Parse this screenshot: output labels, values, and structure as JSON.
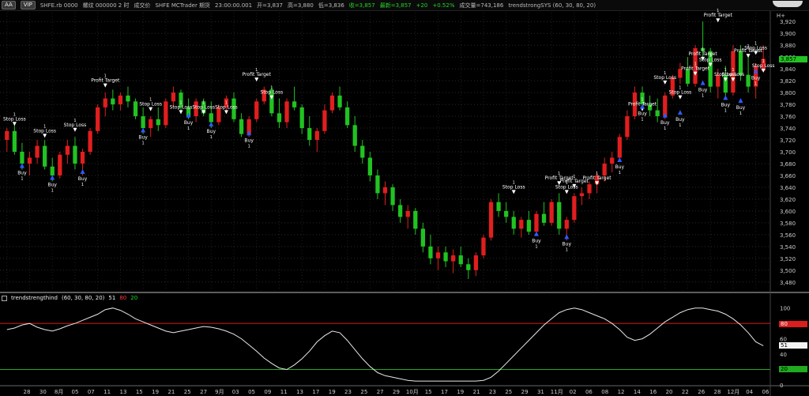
{
  "toolbar": {
    "zoom_label": "AA",
    "tag_label": "VIP",
    "symbol": "SHFE.rb 0000",
    "name": "螺纹 000000 2 时",
    "extra1": "成交价",
    "extra2": "SHFE MCTrader 期货",
    "time": "23:00:00.001",
    "open": "开=3,837",
    "high": "高=3,880",
    "low": "低=3,836",
    "close": "收=3,857",
    "latest": "最新=3,857",
    "change": "+20",
    "change_pct": "+0.52%",
    "volume": "成交量=743,186",
    "strategy": "trendstrongSYS (60, 30, 80, 20)",
    "right_label": "H+"
  },
  "price_panel": {
    "current_price": "3,857",
    "y_ticks": [
      "3,920",
      "3,900",
      "3,880",
      "3,860",
      "3,840",
      "3,820",
      "3,800",
      "3,780",
      "3,760",
      "3,740",
      "3,720",
      "3,700",
      "3,680",
      "3,660",
      "3,640",
      "3,620",
      "3,600",
      "3,580",
      "3,560",
      "3,540",
      "3,520",
      "3,500",
      "3,480"
    ]
  },
  "indicator_panel": {
    "name": "trendstrengthind",
    "params": "(60, 30, 80, 20)",
    "value": "51",
    "upper": "80",
    "lower": "20",
    "y_ticks": [
      "100",
      "80",
      "60",
      "40",
      "20",
      "0"
    ],
    "right_tags": {
      "upper": "80",
      "value": "51",
      "lower": "20"
    }
  },
  "x_axis": {
    "labels": [
      "28",
      "30",
      "8月",
      "05",
      "07",
      "11",
      "13",
      "15",
      "19",
      "21",
      "25",
      "27",
      "9月",
      "03",
      "05",
      "09",
      "11",
      "13",
      "17",
      "19",
      "23",
      "25",
      "27",
      "29",
      "10月",
      "15",
      "17",
      "19",
      "21",
      "23",
      "25",
      "29",
      "31",
      "11月",
      "02",
      "06",
      "08",
      "12",
      "14",
      "16",
      "20",
      "22",
      "26",
      "28",
      "12月",
      "04",
      "06"
    ]
  },
  "chart_data": {
    "type": "candlestick",
    "ylim": [
      3465,
      3935
    ],
    "candles": [
      {
        "i": 0,
        "o": 3720,
        "h": 3740,
        "l": 3700,
        "c": 3735
      },
      {
        "i": 1,
        "o": 3735,
        "h": 3745,
        "l": 3695,
        "c": 3700
      },
      {
        "i": 2,
        "o": 3700,
        "h": 3715,
        "l": 3670,
        "c": 3680
      },
      {
        "i": 3,
        "o": 3680,
        "h": 3700,
        "l": 3660,
        "c": 3690
      },
      {
        "i": 4,
        "o": 3690,
        "h": 3720,
        "l": 3680,
        "c": 3710
      },
      {
        "i": 5,
        "o": 3710,
        "h": 3720,
        "l": 3670,
        "c": 3675
      },
      {
        "i": 6,
        "o": 3675,
        "h": 3690,
        "l": 3650,
        "c": 3660
      },
      {
        "i": 7,
        "o": 3660,
        "h": 3700,
        "l": 3655,
        "c": 3695
      },
      {
        "i": 8,
        "o": 3695,
        "h": 3720,
        "l": 3680,
        "c": 3710
      },
      {
        "i": 9,
        "o": 3710,
        "h": 3725,
        "l": 3670,
        "c": 3680
      },
      {
        "i": 10,
        "o": 3680,
        "h": 3705,
        "l": 3660,
        "c": 3700
      },
      {
        "i": 11,
        "o": 3700,
        "h": 3740,
        "l": 3695,
        "c": 3735
      },
      {
        "i": 12,
        "o": 3735,
        "h": 3780,
        "l": 3730,
        "c": 3775
      },
      {
        "i": 13,
        "o": 3775,
        "h": 3800,
        "l": 3760,
        "c": 3790
      },
      {
        "i": 14,
        "o": 3790,
        "h": 3805,
        "l": 3770,
        "c": 3780
      },
      {
        "i": 15,
        "o": 3780,
        "h": 3800,
        "l": 3770,
        "c": 3795
      },
      {
        "i": 16,
        "o": 3795,
        "h": 3810,
        "l": 3775,
        "c": 3785
      },
      {
        "i": 17,
        "o": 3785,
        "h": 3790,
        "l": 3755,
        "c": 3760
      },
      {
        "i": 18,
        "o": 3760,
        "h": 3775,
        "l": 3730,
        "c": 3740
      },
      {
        "i": 19,
        "o": 3740,
        "h": 3760,
        "l": 3725,
        "c": 3755
      },
      {
        "i": 20,
        "o": 3755,
        "h": 3775,
        "l": 3735,
        "c": 3745
      },
      {
        "i": 21,
        "o": 3745,
        "h": 3790,
        "l": 3740,
        "c": 3785
      },
      {
        "i": 22,
        "o": 3785,
        "h": 3810,
        "l": 3775,
        "c": 3800
      },
      {
        "i": 23,
        "o": 3800,
        "h": 3805,
        "l": 3770,
        "c": 3775
      },
      {
        "i": 24,
        "o": 3775,
        "h": 3790,
        "l": 3755,
        "c": 3760
      },
      {
        "i": 25,
        "o": 3760,
        "h": 3790,
        "l": 3750,
        "c": 3785
      },
      {
        "i": 26,
        "o": 3785,
        "h": 3790,
        "l": 3760,
        "c": 3765
      },
      {
        "i": 27,
        "o": 3765,
        "h": 3785,
        "l": 3740,
        "c": 3750
      },
      {
        "i": 28,
        "o": 3750,
        "h": 3780,
        "l": 3745,
        "c": 3775
      },
      {
        "i": 29,
        "o": 3775,
        "h": 3795,
        "l": 3765,
        "c": 3790
      },
      {
        "i": 30,
        "o": 3790,
        "h": 3800,
        "l": 3750,
        "c": 3755
      },
      {
        "i": 31,
        "o": 3755,
        "h": 3765,
        "l": 3725,
        "c": 3730
      },
      {
        "i": 32,
        "o": 3730,
        "h": 3760,
        "l": 3725,
        "c": 3755
      },
      {
        "i": 33,
        "o": 3755,
        "h": 3790,
        "l": 3750,
        "c": 3785
      },
      {
        "i": 34,
        "o": 3785,
        "h": 3810,
        "l": 3780,
        "c": 3805
      },
      {
        "i": 35,
        "o": 3805,
        "h": 3810,
        "l": 3760,
        "c": 3765
      },
      {
        "i": 36,
        "o": 3765,
        "h": 3790,
        "l": 3740,
        "c": 3750
      },
      {
        "i": 37,
        "o": 3750,
        "h": 3790,
        "l": 3740,
        "c": 3785
      },
      {
        "i": 38,
        "o": 3785,
        "h": 3810,
        "l": 3770,
        "c": 3775
      },
      {
        "i": 39,
        "o": 3775,
        "h": 3780,
        "l": 3730,
        "c": 3740
      },
      {
        "i": 40,
        "o": 3740,
        "h": 3760,
        "l": 3710,
        "c": 3720
      },
      {
        "i": 41,
        "o": 3720,
        "h": 3740,
        "l": 3700,
        "c": 3735
      },
      {
        "i": 42,
        "o": 3735,
        "h": 3780,
        "l": 3730,
        "c": 3770
      },
      {
        "i": 43,
        "o": 3770,
        "h": 3800,
        "l": 3765,
        "c": 3795
      },
      {
        "i": 44,
        "o": 3795,
        "h": 3810,
        "l": 3770,
        "c": 3775
      },
      {
        "i": 45,
        "o": 3775,
        "h": 3785,
        "l": 3740,
        "c": 3745
      },
      {
        "i": 46,
        "o": 3745,
        "h": 3760,
        "l": 3700,
        "c": 3710
      },
      {
        "i": 47,
        "o": 3710,
        "h": 3720,
        "l": 3680,
        "c": 3690
      },
      {
        "i": 48,
        "o": 3690,
        "h": 3700,
        "l": 3650,
        "c": 3660
      },
      {
        "i": 49,
        "o": 3660,
        "h": 3670,
        "l": 3620,
        "c": 3630
      },
      {
        "i": 50,
        "o": 3630,
        "h": 3650,
        "l": 3610,
        "c": 3640
      },
      {
        "i": 51,
        "o": 3640,
        "h": 3645,
        "l": 3600,
        "c": 3610
      },
      {
        "i": 52,
        "o": 3610,
        "h": 3620,
        "l": 3580,
        "c": 3590
      },
      {
        "i": 53,
        "o": 3590,
        "h": 3610,
        "l": 3570,
        "c": 3600
      },
      {
        "i": 54,
        "o": 3600,
        "h": 3605,
        "l": 3560,
        "c": 3570
      },
      {
        "i": 55,
        "o": 3570,
        "h": 3580,
        "l": 3530,
        "c": 3540
      },
      {
        "i": 56,
        "o": 3540,
        "h": 3560,
        "l": 3510,
        "c": 3520
      },
      {
        "i": 57,
        "o": 3520,
        "h": 3540,
        "l": 3500,
        "c": 3530
      },
      {
        "i": 58,
        "o": 3530,
        "h": 3540,
        "l": 3505,
        "c": 3515
      },
      {
        "i": 59,
        "o": 3515,
        "h": 3535,
        "l": 3495,
        "c": 3525
      },
      {
        "i": 60,
        "o": 3525,
        "h": 3540,
        "l": 3505,
        "c": 3510
      },
      {
        "i": 61,
        "o": 3510,
        "h": 3520,
        "l": 3485,
        "c": 3500
      },
      {
        "i": 62,
        "o": 3500,
        "h": 3530,
        "l": 3490,
        "c": 3525
      },
      {
        "i": 63,
        "o": 3525,
        "h": 3560,
        "l": 3520,
        "c": 3555
      },
      {
        "i": 64,
        "o": 3555,
        "h": 3620,
        "l": 3550,
        "c": 3615
      },
      {
        "i": 65,
        "o": 3615,
        "h": 3630,
        "l": 3590,
        "c": 3600
      },
      {
        "i": 66,
        "o": 3600,
        "h": 3615,
        "l": 3580,
        "c": 3590
      },
      {
        "i": 67,
        "o": 3590,
        "h": 3600,
        "l": 3560,
        "c": 3570
      },
      {
        "i": 68,
        "o": 3570,
        "h": 3590,
        "l": 3555,
        "c": 3585
      },
      {
        "i": 69,
        "o": 3585,
        "h": 3600,
        "l": 3560,
        "c": 3565
      },
      {
        "i": 70,
        "o": 3565,
        "h": 3600,
        "l": 3560,
        "c": 3595
      },
      {
        "i": 71,
        "o": 3595,
        "h": 3615,
        "l": 3575,
        "c": 3580
      },
      {
        "i": 72,
        "o": 3580,
        "h": 3620,
        "l": 3575,
        "c": 3615
      },
      {
        "i": 73,
        "o": 3615,
        "h": 3630,
        "l": 3560,
        "c": 3570
      },
      {
        "i": 74,
        "o": 3570,
        "h": 3590,
        "l": 3550,
        "c": 3585
      },
      {
        "i": 75,
        "o": 3585,
        "h": 3630,
        "l": 3580,
        "c": 3625
      },
      {
        "i": 76,
        "o": 3625,
        "h": 3640,
        "l": 3610,
        "c": 3630
      },
      {
        "i": 77,
        "o": 3630,
        "h": 3650,
        "l": 3620,
        "c": 3645
      },
      {
        "i": 78,
        "o": 3645,
        "h": 3665,
        "l": 3630,
        "c": 3660
      },
      {
        "i": 79,
        "o": 3660,
        "h": 3690,
        "l": 3650,
        "c": 3680
      },
      {
        "i": 80,
        "o": 3680,
        "h": 3700,
        "l": 3665,
        "c": 3690
      },
      {
        "i": 81,
        "o": 3690,
        "h": 3730,
        "l": 3685,
        "c": 3725
      },
      {
        "i": 82,
        "o": 3725,
        "h": 3770,
        "l": 3720,
        "c": 3760
      },
      {
        "i": 83,
        "o": 3760,
        "h": 3810,
        "l": 3755,
        "c": 3800
      },
      {
        "i": 84,
        "o": 3800,
        "h": 3810,
        "l": 3770,
        "c": 3780
      },
      {
        "i": 85,
        "o": 3780,
        "h": 3795,
        "l": 3760,
        "c": 3770
      },
      {
        "i": 86,
        "o": 3770,
        "h": 3790,
        "l": 3750,
        "c": 3760
      },
      {
        "i": 87,
        "o": 3760,
        "h": 3800,
        "l": 3755,
        "c": 3795
      },
      {
        "i": 88,
        "o": 3795,
        "h": 3830,
        "l": 3790,
        "c": 3825
      },
      {
        "i": 89,
        "o": 3825,
        "h": 3850,
        "l": 3815,
        "c": 3840
      },
      {
        "i": 90,
        "o": 3840,
        "h": 3860,
        "l": 3810,
        "c": 3815
      },
      {
        "i": 91,
        "o": 3815,
        "h": 3880,
        "l": 3810,
        "c": 3875
      },
      {
        "i": 92,
        "o": 3875,
        "h": 3920,
        "l": 3860,
        "c": 3870
      },
      {
        "i": 93,
        "o": 3870,
        "h": 3875,
        "l": 3800,
        "c": 3810
      },
      {
        "i": 94,
        "o": 3810,
        "h": 3840,
        "l": 3790,
        "c": 3830
      },
      {
        "i": 95,
        "o": 3830,
        "h": 3845,
        "l": 3790,
        "c": 3800
      },
      {
        "i": 96,
        "o": 3800,
        "h": 3880,
        "l": 3795,
        "c": 3870
      },
      {
        "i": 97,
        "o": 3870,
        "h": 3880,
        "l": 3820,
        "c": 3830
      },
      {
        "i": 98,
        "o": 3830,
        "h": 3860,
        "l": 3800,
        "c": 3810
      },
      {
        "i": 99,
        "o": 3810,
        "h": 3850,
        "l": 3790,
        "c": 3845
      },
      {
        "i": 100,
        "o": 3837,
        "h": 3880,
        "l": 3836,
        "c": 3857
      }
    ],
    "signals": [
      {
        "type": "sell",
        "label": "Stop Loss",
        "i": 1,
        "price": 3745
      },
      {
        "type": "buy",
        "label": "Buy",
        "i": 2,
        "price": 3670
      },
      {
        "type": "sell",
        "label": "Stop Loss",
        "i": 5,
        "price": 3725
      },
      {
        "type": "buy",
        "label": "Buy",
        "i": 6,
        "price": 3650
      },
      {
        "type": "sell",
        "label": "Stop Loss",
        "i": 9,
        "price": 3735
      },
      {
        "type": "buy",
        "label": "Buy",
        "i": 10,
        "price": 3660
      },
      {
        "type": "sell",
        "label": "Profit Target",
        "i": 13,
        "price": 3810
      },
      {
        "type": "sell",
        "label": "Stop Loss",
        "i": 19,
        "price": 3770
      },
      {
        "type": "buy",
        "label": "Buy",
        "i": 18,
        "price": 3730
      },
      {
        "type": "sell",
        "label": "Stop Loss",
        "i": 23,
        "price": 3765
      },
      {
        "type": "buy",
        "label": "Buy",
        "i": 24,
        "price": 3755
      },
      {
        "type": "sell",
        "label": "Stop Loss",
        "i": 26,
        "price": 3765
      },
      {
        "type": "buy",
        "label": "Buy",
        "i": 27,
        "price": 3740
      },
      {
        "type": "sell",
        "label": "Stop Loss",
        "i": 29,
        "price": 3765
      },
      {
        "type": "sell",
        "label": "Profit Target",
        "i": 33,
        "price": 3820
      },
      {
        "type": "buy",
        "label": "Buy",
        "i": 32,
        "price": 3725
      },
      {
        "type": "sell",
        "label": "Stop Loss",
        "i": 35,
        "price": 3790
      },
      {
        "type": "sell",
        "label": "Stop Loss",
        "i": 67,
        "price": 3630
      },
      {
        "type": "buy",
        "label": "Buy",
        "i": 70,
        "price": 3555
      },
      {
        "type": "sell",
        "label": "Profit Target",
        "i": 73,
        "price": 3645
      },
      {
        "type": "sell",
        "label": "Stop Loss",
        "i": 74,
        "price": 3630
      },
      {
        "type": "sell",
        "label": "Profit Target",
        "i": 75,
        "price": 3640
      },
      {
        "type": "buy",
        "label": "Buy",
        "i": 74,
        "price": 3550
      },
      {
        "type": "sell",
        "label": "Profit Target",
        "i": 78,
        "price": 3645
      },
      {
        "type": "buy",
        "label": "Buy",
        "i": 81,
        "price": 3680
      },
      {
        "type": "sell",
        "label": "Profit Target",
        "i": 84,
        "price": 3770
      },
      {
        "type": "buy",
        "label": "Buy",
        "i": 84,
        "price": 3770
      },
      {
        "type": "sell",
        "label": "Stop Loss",
        "i": 87,
        "price": 3815
      },
      {
        "type": "buy",
        "label": "Buy",
        "i": 87,
        "price": 3755
      },
      {
        "type": "sell",
        "label": "Stop Loss",
        "i": 89,
        "price": 3790
      },
      {
        "type": "buy",
        "label": "Buy",
        "i": 89,
        "price": 3760
      },
      {
        "type": "sell",
        "label": "Profit Target",
        "i": 91,
        "price": 3830
      },
      {
        "type": "sell",
        "label": "Profit Target",
        "i": 92,
        "price": 3855
      },
      {
        "type": "buy",
        "label": "Buy",
        "i": 92,
        "price": 3810
      },
      {
        "type": "sell",
        "label": "Stop Loss",
        "i": 93,
        "price": 3845
      },
      {
        "type": "sell",
        "label": "Profit Target",
        "i": 94,
        "price": 3920
      },
      {
        "type": "sell",
        "label": "Stop Loss",
        "i": 95,
        "price": 3820
      },
      {
        "type": "buy",
        "label": "Buy",
        "i": 95,
        "price": 3785
      },
      {
        "type": "sell",
        "label": "Stop Loss",
        "i": 96,
        "price": 3820
      },
      {
        "type": "buy",
        "label": "Buy",
        "i": 97,
        "price": 3780
      },
      {
        "type": "sell",
        "label": "Profit Target",
        "i": 98,
        "price": 3860
      },
      {
        "type": "sell",
        "label": "Stop Loss",
        "i": 99,
        "price": 3865
      },
      {
        "type": "buy",
        "label": "Buy",
        "i": 99,
        "price": 3830
      },
      {
        "type": "sell",
        "label": "Stop Loss",
        "i": 100,
        "price": 3835
      }
    ],
    "indicator": {
      "ylim": [
        0,
        110
      ],
      "upper": 80,
      "lower": 20,
      "values": [
        72,
        74,
        78,
        80,
        75,
        72,
        70,
        73,
        77,
        80,
        84,
        88,
        92,
        98,
        100,
        97,
        92,
        86,
        82,
        78,
        74,
        70,
        68,
        70,
        72,
        74,
        76,
        75,
        73,
        70,
        66,
        60,
        52,
        44,
        35,
        28,
        22,
        20,
        26,
        34,
        44,
        56,
        64,
        70,
        68,
        58,
        46,
        34,
        24,
        16,
        12,
        10,
        8,
        6,
        5,
        5,
        5,
        5,
        5,
        5,
        5,
        5,
        5,
        6,
        10,
        18,
        28,
        38,
        48,
        58,
        68,
        78,
        86,
        94,
        98,
        100,
        98,
        94,
        90,
        86,
        80,
        72,
        62,
        58,
        60,
        66,
        74,
        82,
        88,
        94,
        98,
        100,
        100,
        98,
        96,
        92,
        86,
        78,
        68,
        56,
        51
      ],
      "current": 51
    }
  }
}
